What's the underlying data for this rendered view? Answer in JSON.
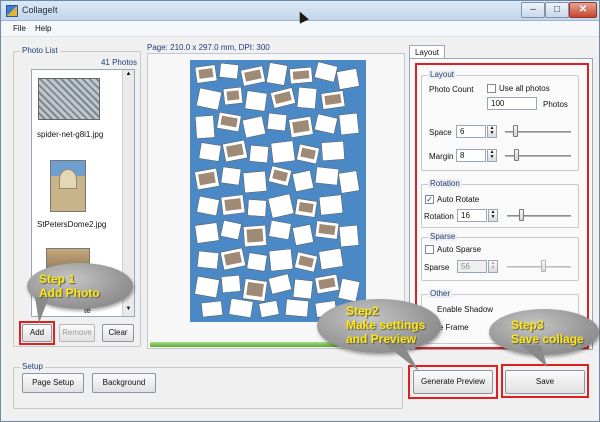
{
  "window": {
    "title": "CollageIt"
  },
  "menu": {
    "file": "File",
    "help": "Help"
  },
  "photo_list": {
    "group_label": "Photo List",
    "count": "41 Photos",
    "items": [
      "spider-net-g8i1.jpg",
      "StPetersDome2.jpg",
      "te"
    ]
  },
  "photo_buttons": {
    "add": "Add",
    "remove": "Remove",
    "clear": "Clear"
  },
  "setup": {
    "group_label": "Setup",
    "page_setup": "Page Setup",
    "background": "Background"
  },
  "canvas": {
    "page_info": "Page: 210.0 x 297.0 mm, DPI: 300"
  },
  "tabs": {
    "layout": "Layout"
  },
  "layout": {
    "group_label": "Layout",
    "photo_count_label": "Photo Count",
    "use_all_photos": "Use all photos",
    "use_all_checked": false,
    "photo_count_value": "100",
    "photos_unit": "Photos",
    "space_label": "Space",
    "space_value": "6",
    "margin_label": "Margin",
    "margin_value": "8"
  },
  "rotation": {
    "group_label": "Rotation",
    "auto_rotate": "Auto Rotate",
    "auto_rotate_checked": true,
    "rotation_label": "Rotation",
    "rotation_value": "16"
  },
  "sparse": {
    "group_label": "Sparse",
    "auto_sparse": "Auto Sparse",
    "auto_sparse_checked": false,
    "sparse_label": "Sparse",
    "sparse_value": "56"
  },
  "other": {
    "group_label": "Other",
    "enable_shadow": "Enable Shadow",
    "frame_partial": "le Frame"
  },
  "actions": {
    "generate_preview": "Generate Preview",
    "save": "Save"
  },
  "callouts": {
    "step1": [
      "Step 1",
      "Add Photo"
    ],
    "step2": [
      "Step2",
      "Make settings",
      "and Preview"
    ],
    "step3": [
      "Step3",
      "Save collage"
    ]
  },
  "colors": {
    "highlight_red": "#e02020",
    "callout_text": "#ffe80a",
    "collage_bg": "#4a89c5"
  }
}
